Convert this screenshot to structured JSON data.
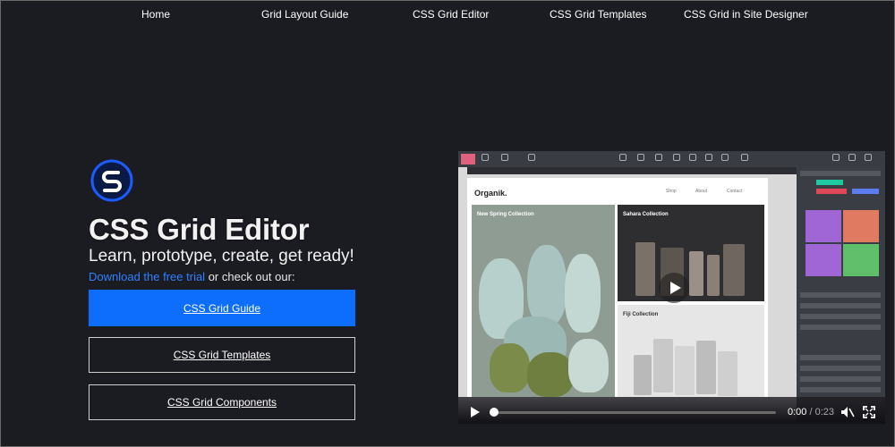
{
  "nav": {
    "items": [
      "Home",
      "Grid Layout Guide",
      "CSS Grid Editor",
      "CSS Grid Templates",
      "CSS Grid in Site Designer"
    ]
  },
  "hero": {
    "logo_icon": "sitejet-s-logo-icon",
    "title": "CSS Grid Editor",
    "subtitle": "Learn, prototype, create, get ready!",
    "trial_link": "Download the free trial",
    "trial_suffix": " or check out our:"
  },
  "buttons": {
    "primary": "CSS Grid Guide",
    "second": "CSS Grid Templates",
    "third": "CSS Grid Components"
  },
  "video": {
    "brand": "Organik.",
    "menu": [
      "Shop",
      "About",
      "Contact"
    ],
    "tiles": [
      "New Spring Collection",
      "Sahara Collection",
      "Fiji Collection"
    ],
    "time_current": "0:00",
    "time_sep": " / ",
    "time_total": "0:23",
    "progress": 0
  },
  "colors": {
    "background": "#1b1b22",
    "accent": "#0d6efd",
    "link": "#2f80ff"
  }
}
